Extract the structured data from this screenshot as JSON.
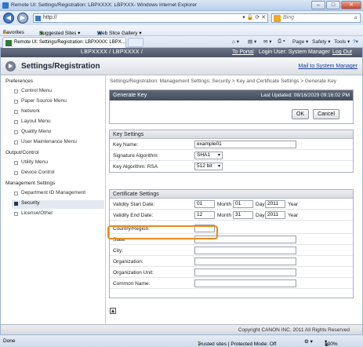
{
  "window": {
    "title": "Remote UI: Settings/Registration: LBPXXXX: LBPXXX- Windows Internet Explorer",
    "min": "–",
    "max": "□",
    "close": "✕"
  },
  "browser": {
    "back": "◀",
    "forward": "▶",
    "address": "http://",
    "search_placeholder": "Bing",
    "favorites_label": "Favorites",
    "suggested_sites": "Suggested Sites ▾",
    "web_slice": "Web Slice Gallery ▾",
    "tab_title": "Remote UI: Settings/Registration: LBPXXXX: LBPX...",
    "cmd_page": "Page ▾",
    "cmd_safety": "Safety ▾",
    "cmd_tools": "Tools ▾",
    "cmd_help": "?▾"
  },
  "topbar": {
    "device_name": "LBPXXXX / LBPXXXX /",
    "to_portal": "To Portal",
    "login_user": "Login User: System Manager",
    "log_out": "Log Out"
  },
  "header": {
    "title": "Settings/Registration",
    "mail_link": "Mail to System Manager"
  },
  "sidebar": {
    "sections": [
      {
        "title": "Preferences",
        "items": [
          "Control Menu",
          "Paper Source Menu",
          "Network",
          "Layout Menu",
          "Quality Menu",
          "User Maintenance Menu"
        ]
      },
      {
        "title": "Output/Control",
        "items": [
          "Utility Menu",
          "Device Control"
        ]
      },
      {
        "title": "Management Settings",
        "items": [
          "Department ID Management",
          "Security",
          "License/Other"
        ]
      }
    ],
    "active": "Security"
  },
  "main": {
    "breadcrumb": "Settings/Registration: Management Settings: Security > Key and Certificate Settings > Generate Key",
    "panel_title": "Generate Key",
    "last_updated": "Last Updated: 08/16/2029 09:16:02 PM",
    "ok_label": "OK",
    "cancel_label": "Cancel",
    "key_settings": {
      "title": "Key Settings",
      "key_name_label": "Key Name:",
      "key_name_value": "example01",
      "sig_algo_label": "Signature Algorithm:",
      "sig_algo_value": "SHA1",
      "key_algo_label": "Key Algorithm: RSA",
      "key_algo_value": "512 bit"
    },
    "cert_settings": {
      "title": "Certificate Settings",
      "start_label": "Validity Start Date:",
      "start_year": "01",
      "start_month_label": "Month",
      "start_month": "01",
      "start_day_label": "Day",
      "start_day": "2011",
      "start_year_label": "Year",
      "end_label": "Validity End Date:",
      "end_year": "12",
      "end_month_label": "Month",
      "end_month": "31",
      "end_day_label": "Day",
      "end_day": "2011",
      "end_year_label": "Year",
      "country_label": "Country/Region:",
      "country_value": "",
      "state_label": "State:",
      "city_label": "City:",
      "org_label": "Organization:",
      "org_unit_label": "Organization Unit:",
      "common_name_label": "Common Name:"
    }
  },
  "footer": {
    "copyright": "Copyright CANON INC. 2011 All Rights Reserved"
  },
  "statusbar": {
    "status": "Done",
    "zone": "Trusted sites | Protected Mode: Off",
    "zoom": "100%"
  }
}
